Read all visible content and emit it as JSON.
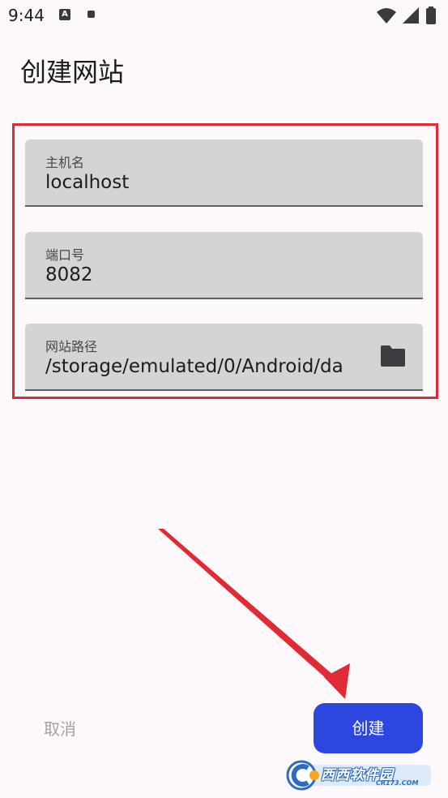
{
  "status_bar": {
    "time": "9:44",
    "notification_letter": "A"
  },
  "page": {
    "title": "创建网站"
  },
  "fields": {
    "hostname": {
      "label": "主机名",
      "value": "localhost"
    },
    "port": {
      "label": "端口号",
      "value": "8082"
    },
    "path": {
      "label": "网站路径",
      "value": "/storage/emulated/0/Android/da"
    }
  },
  "icons": {
    "path_action": "folder-icon",
    "status_wifi": "wifi-icon",
    "status_signal": "signal-icon",
    "status_battery": "battery-icon"
  },
  "actions": {
    "cancel_label": "取消",
    "create_label": "创建"
  },
  "watermark": {
    "main": "西西软件园",
    "sub": "CR173.COM"
  },
  "colors": {
    "primary": "#2e46e0",
    "highlight_frame": "#e02a34",
    "annotation_arrow": "#e02a34",
    "field_background": "#d4d4d4",
    "background": "#fdf8fc"
  }
}
